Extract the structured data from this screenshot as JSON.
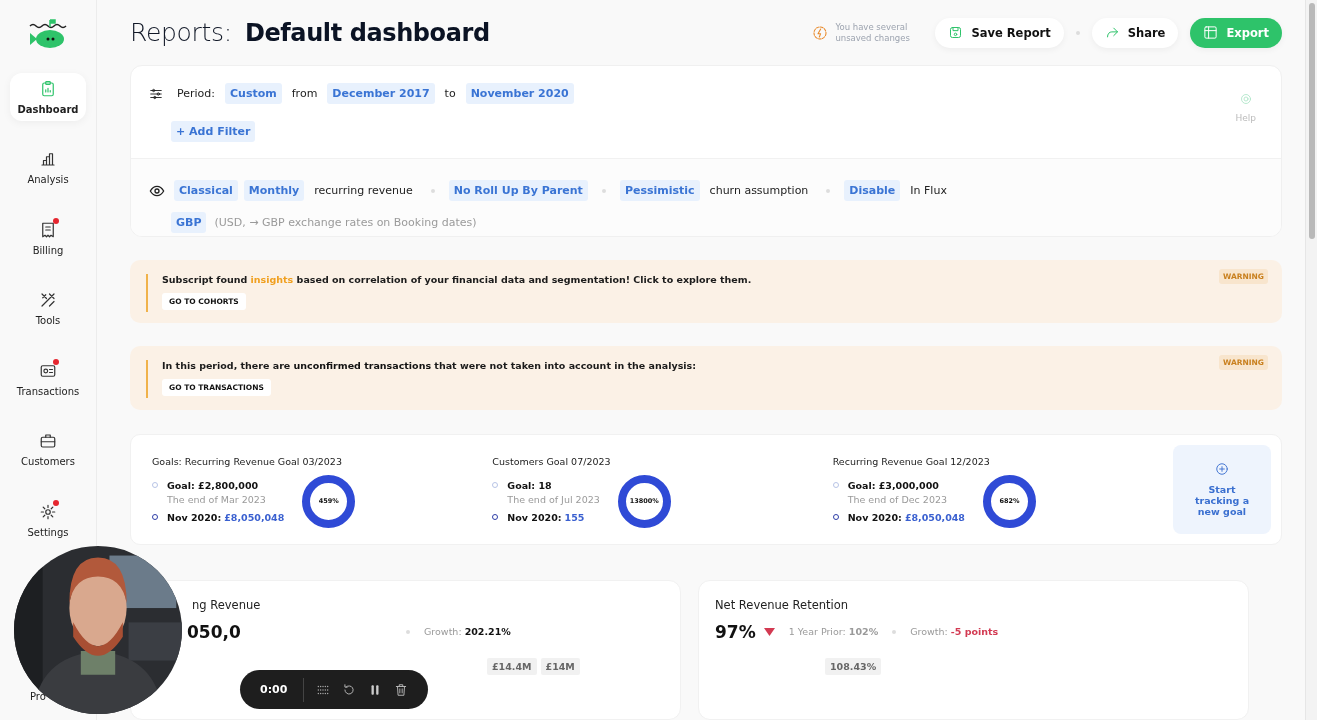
{
  "sidebar": {
    "items": [
      {
        "label": "Dashboard",
        "selected": true,
        "badge": false
      },
      {
        "label": "Analysis",
        "selected": false,
        "badge": false
      },
      {
        "label": "Billing",
        "selected": false,
        "badge": true
      },
      {
        "label": "Tools",
        "selected": false,
        "badge": false
      },
      {
        "label": "Transactions",
        "selected": false,
        "badge": true
      },
      {
        "label": "Customers",
        "selected": false,
        "badge": false
      },
      {
        "label": "Settings",
        "selected": false,
        "badge": true
      }
    ],
    "partial_label": "Pro"
  },
  "header": {
    "title_prefix": "Reports:",
    "title": "Default dashboard",
    "unsaved_notice": "You have several unsaved changes",
    "actions": [
      {
        "label": "Save Report",
        "kind": "secondary"
      },
      {
        "label": "Share",
        "kind": "secondary"
      },
      {
        "label": "Export",
        "kind": "primary"
      }
    ]
  },
  "filters": {
    "period": [
      {
        "kind": "text",
        "text": "Period:"
      },
      {
        "kind": "chip",
        "text": "Custom"
      },
      {
        "kind": "text",
        "text": "from"
      },
      {
        "kind": "chip",
        "text": "December 2017"
      },
      {
        "kind": "text",
        "text": "to"
      },
      {
        "kind": "chip",
        "text": "November 2020"
      }
    ],
    "add_filter": "+ Add Filter",
    "help": "Help"
  },
  "settings": {
    "rows": [
      [
        {
          "kind": "chip",
          "text": "Classical"
        },
        {
          "kind": "chip",
          "text": "Monthly"
        },
        {
          "kind": "text",
          "text": "recurring revenue"
        },
        {
          "kind": "separator"
        },
        {
          "kind": "chip",
          "text": "No Roll Up By Parent"
        },
        {
          "kind": "separator"
        },
        {
          "kind": "chip",
          "text": "Pessimistic"
        },
        {
          "kind": "text",
          "text": "churn assumption"
        },
        {
          "kind": "separator"
        },
        {
          "kind": "chip",
          "text": "Disable"
        },
        {
          "kind": "text",
          "text": "In Flux"
        }
      ],
      [
        {
          "kind": "chip",
          "text": "GBP"
        },
        {
          "kind": "note",
          "text": "(USD, → GBP exchange rates on Booking dates)"
        }
      ]
    ]
  },
  "alerts": [
    {
      "message": "Subscript found **insights** based on correlation of your financial data and segmentation! Click to explore them.",
      "kind": "accent",
      "button": "GO TO COHORTS",
      "tag": "WARNING"
    },
    {
      "message": "In this period, there are **unconfirmed transactions** that were not taken into account in the analysis:",
      "kind": "strong",
      "button": "GO TO TRANSACTIONS",
      "tag": "WARNING"
    }
  ],
  "goals": {
    "items": [
      {
        "title": "Goals: Recurring Revenue Goal 03/2023",
        "goal": "Goal: £2,800,000",
        "deadline": "The end of Mar 2023",
        "current_label": "Nov 2020:",
        "current_value": "£8,050,048",
        "percent": "459%"
      },
      {
        "title": "Customers Goal 07/2023",
        "goal": "Goal: 18",
        "deadline": "The end of Jul 2023",
        "current_label": "Nov 2020:",
        "current_value": "155",
        "percent": "13800%"
      },
      {
        "title": "Recurring Revenue Goal 12/2023",
        "goal": "Goal: £3,000,000",
        "deadline": "The end of Dec 2023",
        "current_label": "Nov 2020:",
        "current_value": "£8,050,048",
        "percent": "682%"
      }
    ],
    "new_goal": "Start tracking a new goal"
  },
  "cards": [
    {
      "title": "ng Revenue",
      "value": "050,0",
      "trend_down": false,
      "growth_label": "Growth:",
      "growth_value": "202.21%",
      "negative": false,
      "labels": [
        "£14.4M",
        "£14M"
      ]
    },
    {
      "title": "Net Revenue Retention",
      "value": "97%",
      "trend_down": true,
      "prior_label": "1 Year Prior:",
      "prior_value": "102%",
      "growth_label": "Growth:",
      "growth_value": "-5 points",
      "negative": true,
      "labels": [
        "108.43%"
      ]
    }
  ],
  "recorder": {
    "time": "0:00"
  }
}
